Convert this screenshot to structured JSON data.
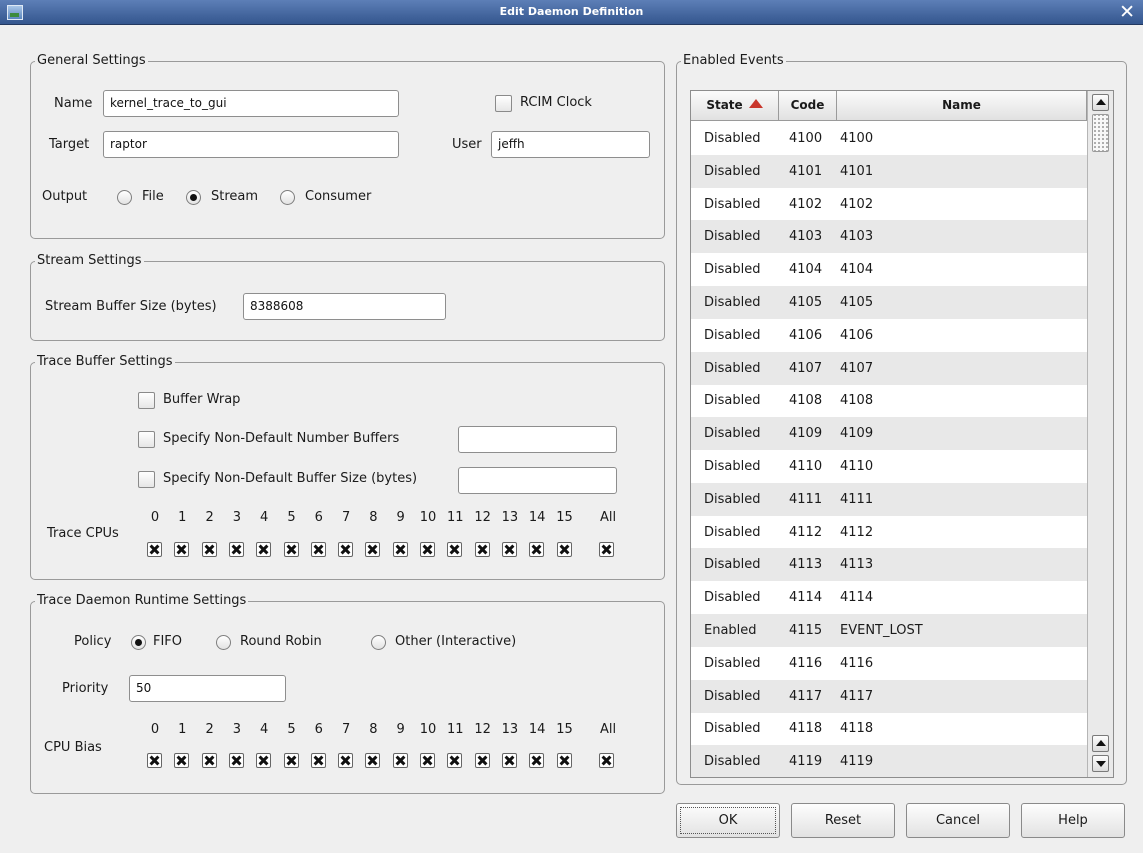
{
  "window": {
    "title": "Edit Daemon Definition",
    "close_glyph": "✕",
    "app_icon": "window-app-icon"
  },
  "general": {
    "legend": "General Settings",
    "name_label": "Name",
    "name_value": "kernel_trace_to_gui",
    "rcim_label": "RCIM Clock",
    "rcim_checked": false,
    "target_label": "Target",
    "target_value": "raptor",
    "user_label": "User",
    "user_value": "jeffh",
    "output_label": "Output",
    "output_options": [
      "File",
      "Stream",
      "Consumer"
    ],
    "output_selected": "Stream"
  },
  "stream": {
    "legend": "Stream Settings",
    "size_label": "Stream Buffer Size (bytes)",
    "size_value": "8388608"
  },
  "trace_buffer": {
    "legend": "Trace Buffer Settings",
    "buffer_wrap_label": "Buffer Wrap",
    "num_buffers_label": "Specify Non-Default Number Buffers",
    "num_buffers_value": "",
    "buffer_size_label": "Specify Non-Default Buffer Size (bytes)",
    "buffer_size_value": "",
    "cpus_label": "Trace CPUs",
    "cpu_numbers": [
      "0",
      "1",
      "2",
      "3",
      "4",
      "5",
      "6",
      "7",
      "8",
      "9",
      "10",
      "11",
      "12",
      "13",
      "14",
      "15"
    ],
    "all_label": "All"
  },
  "runtime": {
    "legend": "Trace Daemon Runtime Settings",
    "policy_label": "Policy",
    "policy_options": [
      "FIFO",
      "Round Robin",
      "Other (Interactive)"
    ],
    "policy_selected": "FIFO",
    "priority_label": "Priority",
    "priority_value": "50",
    "cpu_bias_label": "CPU Bias",
    "cpu_numbers": [
      "0",
      "1",
      "2",
      "3",
      "4",
      "5",
      "6",
      "7",
      "8",
      "9",
      "10",
      "11",
      "12",
      "13",
      "14",
      "15"
    ],
    "all_label": "All"
  },
  "events": {
    "legend": "Enabled Events",
    "columns": [
      "State",
      "Code",
      "Name"
    ],
    "sort_column": "State",
    "rows": [
      {
        "state": "Disabled",
        "code": "4100",
        "name": "4100"
      },
      {
        "state": "Disabled",
        "code": "4101",
        "name": "4101"
      },
      {
        "state": "Disabled",
        "code": "4102",
        "name": "4102"
      },
      {
        "state": "Disabled",
        "code": "4103",
        "name": "4103"
      },
      {
        "state": "Disabled",
        "code": "4104",
        "name": "4104"
      },
      {
        "state": "Disabled",
        "code": "4105",
        "name": "4105"
      },
      {
        "state": "Disabled",
        "code": "4106",
        "name": "4106"
      },
      {
        "state": "Disabled",
        "code": "4107",
        "name": "4107"
      },
      {
        "state": "Disabled",
        "code": "4108",
        "name": "4108"
      },
      {
        "state": "Disabled",
        "code": "4109",
        "name": "4109"
      },
      {
        "state": "Disabled",
        "code": "4110",
        "name": "4110"
      },
      {
        "state": "Disabled",
        "code": "4111",
        "name": "4111"
      },
      {
        "state": "Disabled",
        "code": "4112",
        "name": "4112"
      },
      {
        "state": "Disabled",
        "code": "4113",
        "name": "4113"
      },
      {
        "state": "Disabled",
        "code": "4114",
        "name": "4114"
      },
      {
        "state": "Enabled",
        "code": "4115",
        "name": "EVENT_LOST"
      },
      {
        "state": "Disabled",
        "code": "4116",
        "name": "4116"
      },
      {
        "state": "Disabled",
        "code": "4117",
        "name": "4117"
      },
      {
        "state": "Disabled",
        "code": "4118",
        "name": "4118"
      },
      {
        "state": "Disabled",
        "code": "4119",
        "name": "4119"
      }
    ]
  },
  "buttons": {
    "ok": "OK",
    "reset": "Reset",
    "cancel": "Cancel",
    "help": "Help"
  },
  "colors": {
    "titlebar": "#34568e",
    "sort_arrow": "#c9362c",
    "row_alt": "#e8e8e8"
  }
}
